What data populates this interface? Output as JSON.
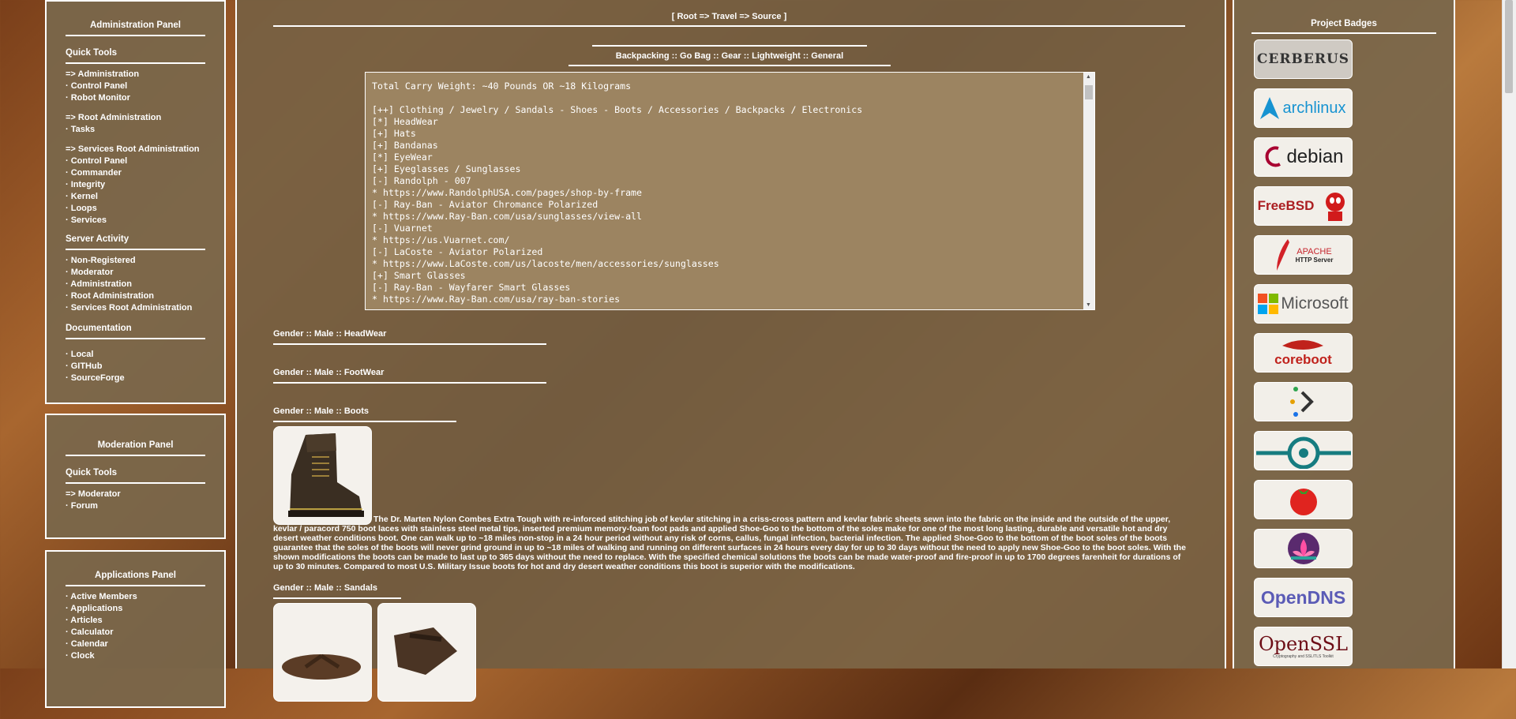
{
  "admin_panel": {
    "title": "Administration Panel",
    "quick_tools": {
      "title": "Quick Tools",
      "items": [
        "=> Administration",
        "· Control Panel",
        "· Robot Monitor"
      ]
    },
    "root_admin": [
      "=> Root Administration",
      "· Tasks"
    ],
    "services_root": [
      "=> Services Root Administration",
      "· Control Panel",
      "· Commander",
      "· Integrity",
      "· Kernel",
      "· Loops",
      "· Services"
    ],
    "server_activity": {
      "title": "Server Activity",
      "items": [
        "· Non-Registered",
        "· Moderator",
        "· Administration",
        "· Root Administration",
        "· Services Root Administration"
      ]
    },
    "documentation": {
      "title": "Documentation",
      "items": [
        "· Local",
        "· GITHub",
        "· SourceForge"
      ]
    }
  },
  "moderation_panel": {
    "title": "Moderation Panel",
    "quick_tools": {
      "title": "Quick Tools",
      "items": [
        "=> Moderator",
        "· Forum"
      ]
    }
  },
  "applications_panel": {
    "title": "Applications Panel",
    "items": [
      "· Active Members",
      "· Applications",
      "· Articles",
      "· Calculator",
      "· Calendar",
      "· Clock"
    ]
  },
  "main": {
    "breadcrumb": "[ Root => Travel => Source ]",
    "category": "Backpacking :: Go Bag :: Gear :: Lightweight :: General",
    "code_lines": [
      "Total Carry Weight: ~40 Pounds OR ~18 Kilograms",
      "",
      "[++] Clothing / Jewelry / Sandals - Shoes - Boots / Accessories / Backpacks / Electronics",
      "[*] HeadWear",
      "[+] Hats",
      "[+] Bandanas",
      "[*] EyeWear",
      "[+] Eyeglasses / Sunglasses",
      "[-] Randolph - 007",
      "* https://www.RandolphUSA.com/pages/shop-by-frame",
      "[-] Ray-Ban - Aviator Chromance Polarized",
      "* https://www.Ray-Ban.com/usa/sunglasses/view-all",
      "[-] Vuarnet",
      "* https://us.Vuarnet.com/",
      "[-] LaCoste - Aviator Polarized",
      "* https://www.LaCoste.com/us/lacoste/men/accessories/sunglasses",
      "[+] Smart Glasses",
      "[-] Ray-Ban - Wayfarer Smart Glasses",
      "* https://www.Ray-Ban.com/usa/ray-ban-stories"
    ],
    "sections": {
      "headwear": "Gender :: Male :: HeadWear",
      "footwear": "Gender :: Male :: FootWear",
      "boots": "Gender :: Male :: Boots",
      "sandals": "Gender :: Male :: Sandals"
    },
    "boots_description": "The Dr. Marten Nylon Combes Extra Tough with re-inforced stitching job of kevlar stitching in a criss-cross pattern and kevlar fabric sheets sewn into the fabric on the inside and the outside of the upper, kevlar / paracord 750 boot laces with stainless steel metal tips, inserted premium memory-foam foot pads and applied Shoe-Goo to the bottom of the soles make for one of the most long lasting, durable and versatile hot and dry desert weather conditions boot. One can walk up to ~18 miles non-stop in a 24 hour period without any risk of corns, callus, fungal infection, bacterial infection. The applied Shoe-Goo to the bottom of the boot soles of the boots guarantee that the soles of the boots will never grind ground in up to ~18 miles of walking and running on different surfaces in 24 hours every day for up to 30 days without the need to apply new Shoe-Goo to the boot soles. With the shown modifications the boots can be made to last up to 365 days without the need to replace. With the specified chemical solutions the boots can be made water-proof and fire-proof in up to 1700 degrees farenheit for durations of up to 30 minutes. Compared to most U.S. Military Issue boots for hot and dry desert weather conditions this boot is superior with the modifications."
  },
  "project_badges": {
    "title": "Project Badges",
    "badges": [
      {
        "icon": "cerberus-logo",
        "text": "CERBERUS"
      },
      {
        "icon": "archlinux-logo",
        "text": "archlinux"
      },
      {
        "icon": "debian-logo",
        "text": "debian"
      },
      {
        "icon": "freebsd-logo",
        "text": "FreeBSD"
      },
      {
        "icon": "apache-logo",
        "text": "APACHE",
        "sub": "HTTP Server"
      },
      {
        "icon": "microsoft-logo",
        "text": "Microsoft"
      },
      {
        "icon": "coreboot-logo",
        "text": "coreboot"
      },
      {
        "icon": "terminal-dots-logo",
        "text": ""
      },
      {
        "icon": "lineage-logo",
        "text": ""
      },
      {
        "icon": "tomato-logo",
        "text": ""
      },
      {
        "icon": "lotus-logo",
        "text": ""
      },
      {
        "icon": "opendns-logo",
        "text": "OpenDNS"
      },
      {
        "icon": "openssl-logo",
        "text": "OpenSSL",
        "sub": "Cryptography and SSL/TLS Toolkit"
      }
    ]
  }
}
